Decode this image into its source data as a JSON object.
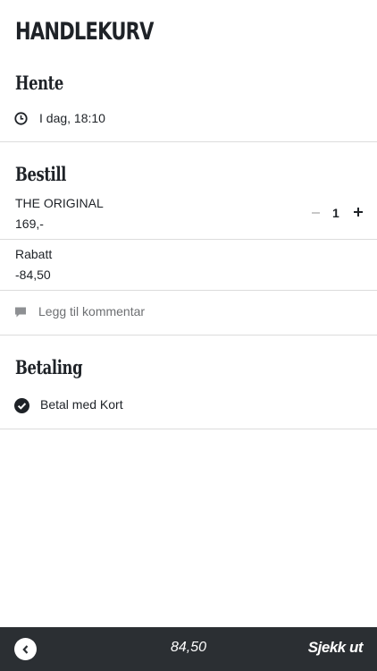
{
  "header": {
    "title": "HANDLEKURV"
  },
  "pickup": {
    "heading": "Hente",
    "time": "I dag, 18:10",
    "icon": "clock-icon"
  },
  "order": {
    "heading": "Bestill",
    "item": {
      "name": "THE ORIGINAL",
      "price": "169,-",
      "quantity": "1"
    },
    "discount": {
      "label": "Rabatt",
      "amount": "-84,50"
    },
    "comment_label": "Legg til kommentar"
  },
  "payment": {
    "heading": "Betaling",
    "method": "Betal med Kort",
    "icon": "check-circle-icon"
  },
  "bottom_bar": {
    "total": "84,50",
    "checkout_label": "Sjekk ut",
    "background": "#2b2f33"
  }
}
